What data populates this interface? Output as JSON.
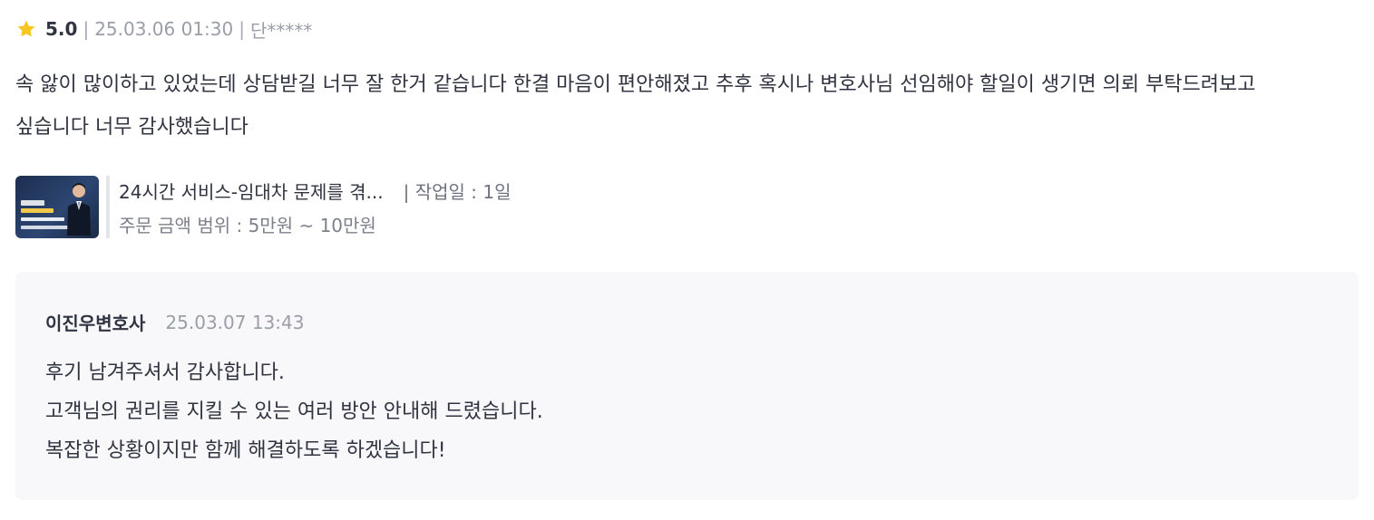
{
  "review": {
    "rating": "5.0",
    "date": "25.03.06 01:30",
    "author": "단*****",
    "separator": "|",
    "body": "속 앓이 많이하고 있었는데 상담받길 너무 잘 한거 같습니다 한결 마음이 편안해졌고 추후 혹시나 변호사님 선임해야 할일이 생기면 의뢰 부탁드려보고 싶습니다 너무 감사했습니다",
    "star_color": "#f7c623"
  },
  "service": {
    "title": "24시간 서비스-임대차 문제를 겪...",
    "work_days": "| 작업일 : 1일",
    "price_range": "주문 금액 범위 : 5만원 ~ 10만원",
    "thumbnail_icon": "lawyer-service-thumbnail"
  },
  "reply": {
    "author": "이진우변호사",
    "date": "25.03.07 13:43",
    "lines": [
      "후기 남겨주셔서 감사합니다.",
      "고객님의 권리를 지킬 수 있는 여러 방안 안내해 드렸습니다.",
      "복잡한 상황이지만 함께 해결하도록 하겠습니다!"
    ]
  }
}
